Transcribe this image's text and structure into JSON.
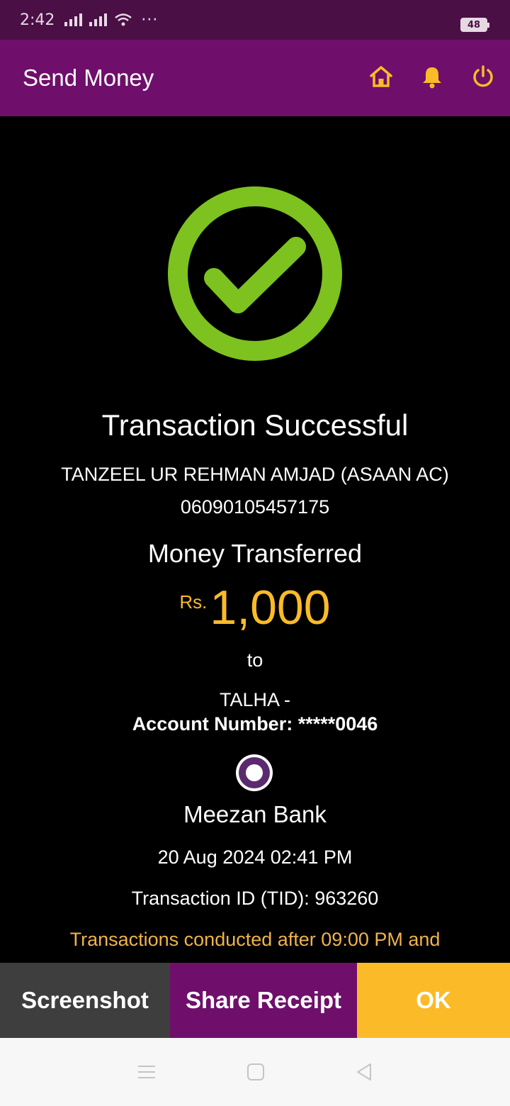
{
  "status_bar": {
    "time": "2:42",
    "battery": "48"
  },
  "app_bar": {
    "title": "Send Money",
    "icons": [
      "home-icon",
      "bell-icon",
      "power-icon"
    ]
  },
  "receipt": {
    "status": "Transaction Successful",
    "sender_name": "TANZEEL UR REHMAN AMJAD (ASAAN AC)",
    "sender_account": "06090105457175",
    "money_label": "Money Transferred",
    "currency": "Rs.",
    "amount": "1,000",
    "to_label": "to",
    "recipient_name": "TALHA -",
    "account_label": "Account Number: *****0046",
    "bank_name": "Meezan Bank",
    "datetime": "20 Aug 2024 02:41 PM",
    "tid": "Transaction ID (TID): 963260",
    "notice": "Transactions conducted after 09:00 PM and"
  },
  "actions": {
    "screenshot": "Screenshot",
    "share": "Share Receipt",
    "ok": "OK"
  },
  "colors": {
    "brand_purple": "#6f0f6b",
    "accent_yellow": "#fbbb28",
    "success_green": "#7dc21e"
  }
}
